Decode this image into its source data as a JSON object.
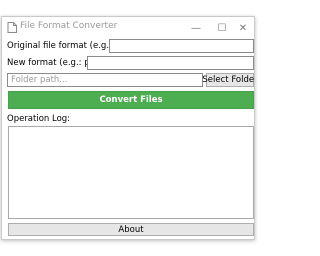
{
  "window": {
    "title": "File Format Converter",
    "controls": {
      "minimize_glyph": "—",
      "maximize_glyph": "☐",
      "close_glyph": "✕"
    },
    "icon": "app-document-icon"
  },
  "form": {
    "original_format": {
      "label": "Original file format (e.g.: jpg):",
      "value": ""
    },
    "new_format": {
      "label": "New format (e.g.: png):",
      "value": ""
    },
    "folder": {
      "placeholder": "Folder path...",
      "value": ""
    },
    "select_folder_label": "Select Folder",
    "convert_label": "Convert Files"
  },
  "log": {
    "label": "Operation Log:",
    "content": ""
  },
  "footer": {
    "about_label": "About"
  },
  "colors": {
    "convert_button": "#4cae50",
    "convert_text": "#ffffff",
    "button_face": "#e6e6e6"
  }
}
